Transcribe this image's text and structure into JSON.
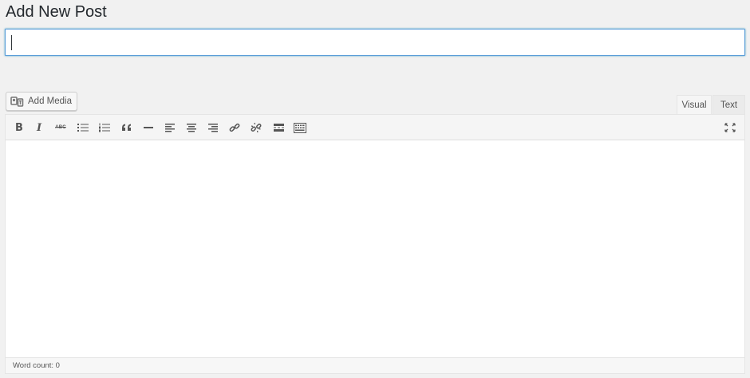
{
  "page": {
    "title": "Add New Post"
  },
  "title_field": {
    "value": "",
    "placeholder": ""
  },
  "media": {
    "add_media_label": "Add Media",
    "icon": "media-camera-icon"
  },
  "tabs": [
    {
      "label": "Visual",
      "active": true
    },
    {
      "label": "Text",
      "active": false
    }
  ],
  "toolbar": {
    "bold_glyph": "B",
    "italic_glyph": "I",
    "strike_glyph": "ABC",
    "buttons": [
      "bold",
      "italic",
      "strikethrough",
      "bulleted-list",
      "numbered-list",
      "blockquote",
      "horizontal-line",
      "align-left",
      "align-center",
      "align-right",
      "insert-link",
      "remove-link",
      "read-more",
      "toolbar-toggle",
      "fullscreen"
    ]
  },
  "status": {
    "word_count_label": "Word count: 0"
  },
  "colors": {
    "accent_focus": "#5b9dd9",
    "background": "#f1f1f1",
    "toolbar": "#f5f5f5"
  }
}
